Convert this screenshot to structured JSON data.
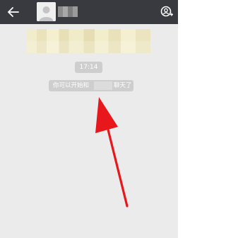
{
  "header": {
    "back_icon": "arrow-left-icon",
    "contact_name": "",
    "profile_icon": "person-settings-icon",
    "bar_color": "#393a3f"
  },
  "chat": {
    "timestamp": "17:14",
    "system_message_prefix": "你可以开始和",
    "system_message_name": "",
    "system_message_suffix": "聊天了"
  },
  "annotation": {
    "arrow_color": "#e8171b",
    "arrow_icon": "red-arrow-annotation"
  }
}
